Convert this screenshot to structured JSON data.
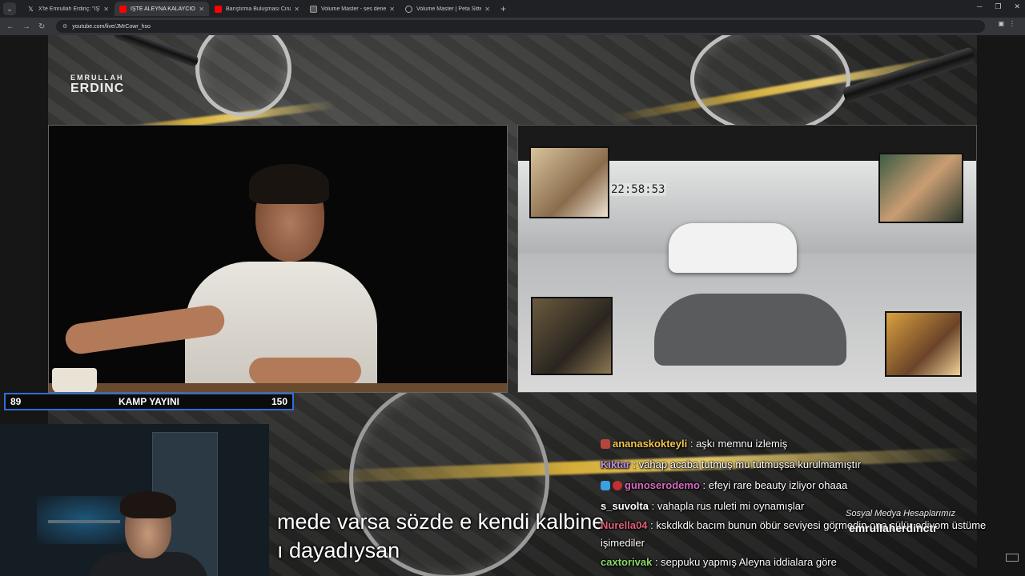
{
  "browser": {
    "tabs": [
      {
        "title": "X'te Emrullah Erdinç: \"İŞTE ALEY",
        "favicon": "x-icon",
        "active": false
      },
      {
        "title": "İŞTE ALEYNA KALAYCIOĞLU",
        "favicon": "youtube-icon",
        "active": true
      },
      {
        "title": "Barıştırma Buluşması Cinayetle",
        "favicon": "youtube-icon",
        "active": false
      },
      {
        "title": "Volume Master - ses denetleyici",
        "favicon": "volume-master-icon",
        "active": false
      },
      {
        "title": "Volume Master | Peta Sittek",
        "favicon": "circle-icon",
        "active": false
      }
    ],
    "url": "youtube.com/live/JMrCowr_hso"
  },
  "brand_top": "EMRULLAH ERDINC",
  "logo": {
    "line1": "EMRULLAH",
    "line2": "ERDINC"
  },
  "kamp_bar": {
    "left": "89",
    "title": "KAMP YAYINI",
    "right": "150"
  },
  "cctv": {
    "timestamp": "22:58:53"
  },
  "subtitle": {
    "line1": "mede varsa sözde e kendi kalbine",
    "line2": "ı dayadıysan"
  },
  "chat": [
    {
      "user": "ananaskokteyli",
      "message": "aşkı memnu izlemiş",
      "color": "#f5c64e",
      "badge": "#b5473a"
    },
    {
      "user": "Kiktar",
      "message": "vahap acaba tutmuş mu tutmuşsa kurulmamıştır",
      "color": "#b58cf0",
      "badge": null
    },
    {
      "user": "gunoserodemo",
      "message": "efeyi rare beauty izliyor ohaaa",
      "color": "#d86ac0",
      "badge": "#3aa0e0"
    },
    {
      "user": "s_suvolta",
      "message": "vahapla rus ruleti mi oynamışlar",
      "color": "#ffffff",
      "badge": null
    },
    {
      "user": "Nurella04",
      "message": "kskdkdk bacım bunun öbür seviyesi görmedin ona şülür ediyom üstüme işimediler",
      "color": "#e0607a",
      "badge": null
    },
    {
      "user": "caxtorivak",
      "message": "seppuku yapmış Aleyna iddialara göre",
      "color": "#8bd96b",
      "badge": null
    }
  ],
  "social": {
    "heading": "Sosyal Medya Hesaplarımız",
    "handle": "emrullaherdinctr"
  }
}
